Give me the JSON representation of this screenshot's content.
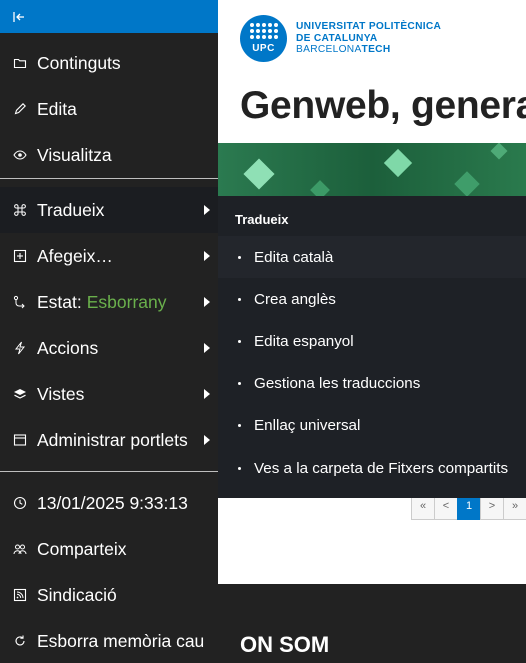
{
  "toolbar": {
    "main_items": [
      {
        "label": "Continguts",
        "icon": "folder-icon"
      },
      {
        "label": "Edita",
        "icon": "pencil-icon"
      },
      {
        "label": "Visualitza",
        "icon": "eye-icon"
      }
    ],
    "sub_items": [
      {
        "label": "Tradueix",
        "icon": "command-icon"
      },
      {
        "label": "Afegeix…",
        "icon": "plus-square-icon"
      },
      {
        "label": "Estat:",
        "value": "Esborrany",
        "icon": "workflow-icon"
      },
      {
        "label": "Accions",
        "icon": "lightning-icon"
      },
      {
        "label": "Vistes",
        "icon": "layers-icon"
      },
      {
        "label": "Administrar portlets",
        "icon": "window-icon"
      }
    ],
    "bottom_items": [
      {
        "label": "13/01/2025 9:33:13",
        "icon": "clock-icon"
      },
      {
        "label": "Comparteix",
        "icon": "users-icon"
      },
      {
        "label": "Sindicació",
        "icon": "rss-icon"
      },
      {
        "label": "Esborra memòria cau",
        "icon": "refresh-icon"
      }
    ]
  },
  "colors": {
    "toolbar_bg": "#222222",
    "collapse_bar": "#0077c8",
    "state_value": "#6ab04c",
    "brand_blue": "#0077c8",
    "banner_green": "#1f6b43"
  },
  "brand": {
    "logo_text": "UPC",
    "line1": "UNIVERSITAT POLITÈCNICA",
    "line2": "DE CATALUNYA",
    "line3_regular": "BARCELONA",
    "line3_bold": "TECH"
  },
  "page": {
    "title_bold": "Genweb",
    "title_rest": ", genera"
  },
  "pager": {
    "first": "«",
    "prev": "<",
    "current": "1",
    "next": ">",
    "last": "»"
  },
  "submenu": {
    "title": "Tradueix",
    "items": [
      "Edita català",
      "Crea anglès",
      "Edita espanyol",
      "Gestiona les traduccions",
      "Enllaç universal",
      "Ves a la carpeta de Fitxers compartits"
    ]
  },
  "footer": {
    "title": "ON SOM"
  }
}
